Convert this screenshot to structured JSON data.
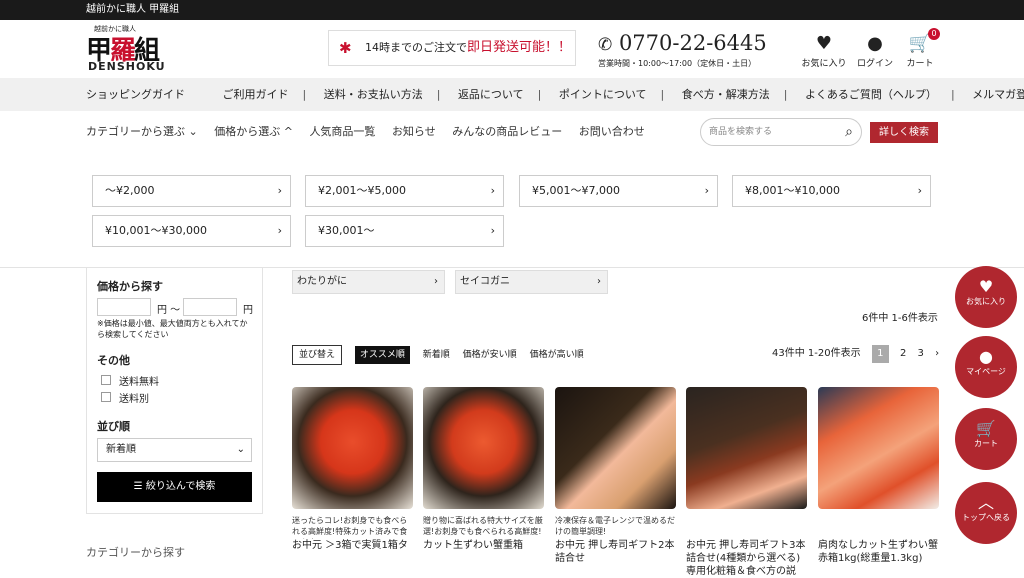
{
  "topbar": {
    "text": "越前かに職人 甲羅組"
  },
  "logo": {
    "small": "越前かに職人",
    "mark_a": "甲",
    "mark_b": "羅",
    "mark_c": "組",
    "english": "DENSHOKU"
  },
  "notice": {
    "prefix": "14時までのご注文で",
    "highlight": "即日発送可能！！"
  },
  "phone": {
    "number": "0770-22-6445",
    "hours": "営業時間・10:00～17:00（定休日・土日）"
  },
  "header_icons": {
    "favorites": "お気に入り",
    "login": "ログイン",
    "cart": "カート",
    "cart_count": "0"
  },
  "nav_main": [
    "ショッピングガイド",
    "ご利用ガイド",
    "送料・お支払い方法",
    "返品について",
    "ポイントについて",
    "食べ方・解凍方法",
    "よくあるご質問（ヘルプ）",
    "メルマガ登録"
  ],
  "nav_sub": [
    "カテゴリーから選ぶ ⌄",
    "価格から選ぶ ^",
    "人気商品一覧",
    "お知らせ",
    "みんなの商品レビュー",
    "お問い合わせ"
  ],
  "search": {
    "placeholder": "商品を検索する",
    "detail_button": "詳しく検索"
  },
  "price_ranges": [
    "～¥2,000",
    "¥2,001～¥5,000",
    "¥5,001～¥7,000",
    "¥8,001～¥10,000",
    "¥10,001～¥30,000",
    "¥30,001～"
  ],
  "sidebar": {
    "price_title": "価格から探す",
    "yen_sep": "円 ～",
    "yen": "円",
    "price_note": "※価格は最小値、最大値両方とも入れてから検索してください",
    "other_title": "その他",
    "options": [
      "送料無料",
      "送料別"
    ],
    "sort_title": "並び順",
    "sort_value": "新着順",
    "filter_button": "絞り込んで検索",
    "category_below": "カテゴリーから探す"
  },
  "tags": [
    "わたりがに",
    "セイコガニ"
  ],
  "count_top": "6件中 1-6件表示",
  "sort": {
    "label": "並び替え",
    "options": [
      "オススメ順",
      "新着順",
      "価格が安い順",
      "価格が高い順"
    ]
  },
  "pager": {
    "summary": "43件中 1-20件表示",
    "pages": [
      "1",
      "2",
      "3"
    ],
    "next": "›"
  },
  "products": [
    {
      "desc": "迷ったらコレ!お刺身でも食べられる高鮮度!特殊カット済みで食べやすい♪",
      "name": "お中元 ＞3箱で実質1箱タ"
    },
    {
      "desc": "贈り物に喜ばれる特大サイズを厳選!お刺身でも食べられる高鮮度!",
      "name": "カット生ずわい蟹重箱"
    },
    {
      "desc": "冷凍保存＆電子レンジで温めるだけの簡単調理!",
      "name": "お中元 押し寿司ギフト2本詰合せ"
    },
    {
      "desc": "",
      "name": "お中元 押し寿司ギフト3本詰合せ(4種類から選べる)専用化粧箱＆食べ方の説"
    },
    {
      "desc": "",
      "name": "肩肉なしカット生ずわい蟹 赤箱1kg(総重量1.3kg)"
    }
  ],
  "fabs": {
    "favorites": "お気に入り",
    "mypage": "マイページ",
    "cart": "カート",
    "top": "トップへ戻る"
  }
}
